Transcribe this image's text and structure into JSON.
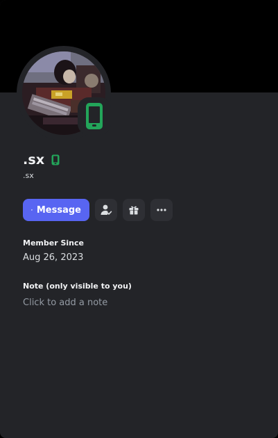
{
  "profile": {
    "display_name": ".sx",
    "username": ".sx",
    "status": "mobile-online",
    "status_color": "#23a55a"
  },
  "actions": {
    "message_label": "Message",
    "message_icon": "chat-bubble-icon",
    "add_friend_icon": "friend-request-pending-icon",
    "gift_icon": "gift-icon",
    "more_icon": "more-horizontal-icon"
  },
  "member_since": {
    "label": "Member Since",
    "value": "Aug 26, 2023"
  },
  "note": {
    "label": "Note (only visible to you)",
    "placeholder": "Click to add a note",
    "value": ""
  },
  "colors": {
    "accent": "#5865f2",
    "card_bg": "#232428",
    "banner_bg": "#000000",
    "online": "#23a55a"
  }
}
